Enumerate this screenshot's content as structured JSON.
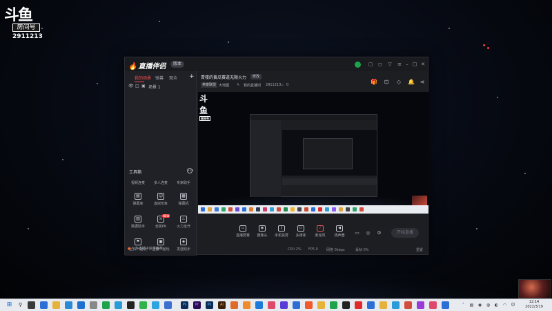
{
  "desktop": {
    "room_badge": {
      "logo": "斗鱼",
      "tag": "房间号",
      "room_id": "2911213"
    }
  },
  "app": {
    "title_logo": "直播伴侣",
    "version_badge": "版本",
    "sidebar": {
      "tabs": [
        "我的场景",
        "弹幕",
        "观众"
      ],
      "add_symbol": "+",
      "scene_name": "场景 1",
      "tools_title": "工具箱",
      "tools": [
        {
          "label": "视频连麦",
          "icon": "video-link-icon"
        },
        {
          "label": "多人连麦",
          "icon": "multi-link-icon"
        },
        {
          "label": "专家助手",
          "icon": "expert-icon"
        },
        {
          "label": "弹幕库",
          "icon": "danmaku-icon"
        },
        {
          "label": "虚拟形象",
          "icon": "avatar-icon"
        },
        {
          "label": "弹幕机",
          "icon": "danmaku-machine-icon"
        },
        {
          "label": "数据助手",
          "icon": "data-icon"
        },
        {
          "label": "全民PK",
          "icon": "pk-icon",
          "badge": "NEW"
        },
        {
          "label": "火力全开",
          "icon": "fire-icon"
        },
        {
          "label": "上头一起玩",
          "icon": "play-icon"
        },
        {
          "label": "主播一起玩",
          "icon": "anchor-play-icon"
        },
        {
          "label": "发送助手",
          "icon": "send-icon"
        }
      ],
      "footer": "5 条直播中获得推荐"
    },
    "header": {
      "room_title": "青楼的黄瓜赛道无限火力",
      "edit_label": "修改",
      "category": "英雄联盟",
      "subcategory": "大地图",
      "meta_anchor": "我的直播间",
      "meta_room": "2911213",
      "meta_hot": "0"
    },
    "preview": {
      "mini_logo": "斗鱼",
      "mini_tag": "房间号"
    },
    "bottom_toolbar": [
      {
        "label": "直播屏幕",
        "icon": "screen-icon"
      },
      {
        "label": "摄像头",
        "icon": "camera-icon"
      },
      {
        "label": "手机投屏",
        "icon": "phone-cast-icon"
      },
      {
        "label": "多媒体",
        "icon": "media-icon"
      },
      {
        "label": "麦克风",
        "icon": "mic-icon"
      },
      {
        "label": "扬声器",
        "icon": "speaker-icon"
      }
    ],
    "live_button": "开始直播",
    "status": {
      "cpu": "CPU 2%",
      "fps": "FPS 0",
      "net": "网络 0kbps",
      "drop": "丢帧 0%",
      "reset": "重置"
    }
  },
  "taskbar": {
    "time": "12:14",
    "date": "2022/3/19"
  }
}
